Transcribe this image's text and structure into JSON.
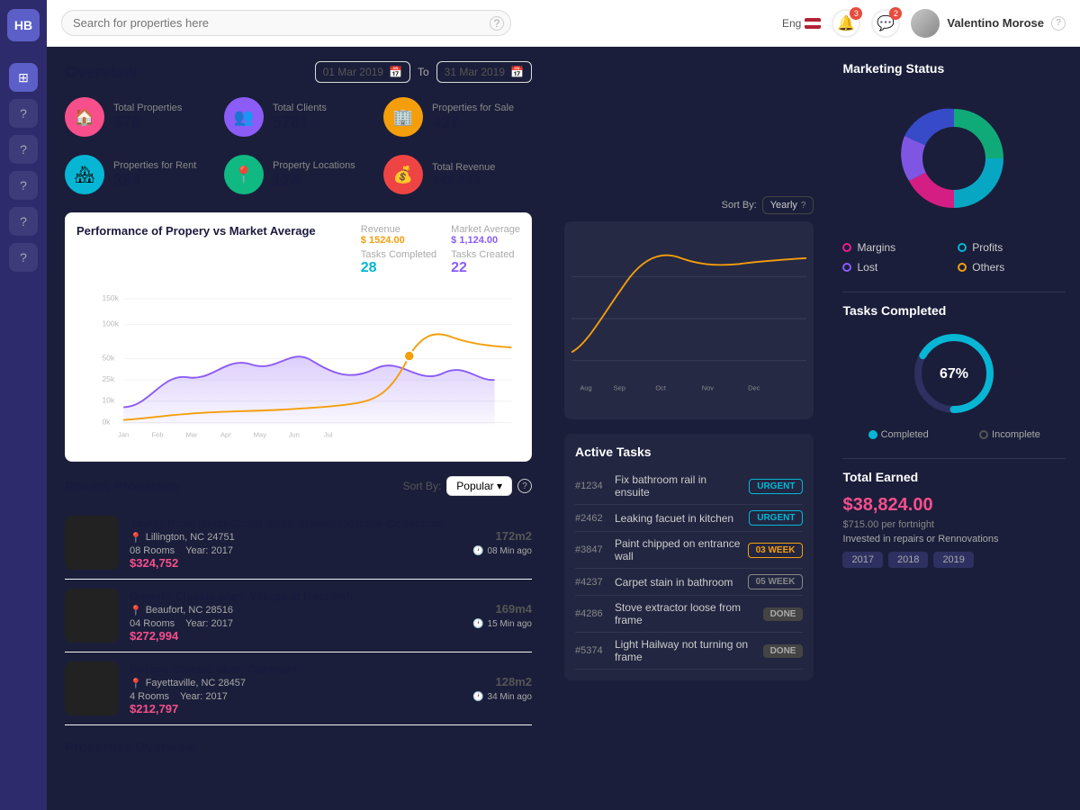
{
  "app": {
    "logo": "HB",
    "search_placeholder": "Search for properties here"
  },
  "topnav": {
    "language": "Eng",
    "user_name": "Valentino Morose",
    "help_label": "?"
  },
  "overview": {
    "title": "Overview",
    "date_from": "01 Mar 2019",
    "date_to": "31 Mar 2019",
    "to_label": "To"
  },
  "stats": [
    {
      "label": "Total Properties",
      "value": "678",
      "icon": "🏠",
      "color": "pink"
    },
    {
      "label": "Total Clients",
      "value": "5781",
      "icon": "👥",
      "color": "purple"
    },
    {
      "label": "Properties for Sale",
      "value": "427",
      "icon": "🏢",
      "color": "orange"
    },
    {
      "label": "Properties for Rent",
      "value": "394",
      "icon": "🏘",
      "color": "cyan"
    },
    {
      "label": "Property Locations",
      "value": "124",
      "icon": "📍",
      "color": "green"
    },
    {
      "label": "Total Revenue",
      "value": "$48,752",
      "icon": "💰",
      "color": "red"
    }
  ],
  "chart": {
    "title": "Performance of Propery vs Market Average",
    "sort_label": "Sort By:",
    "sort_value": "Yearly",
    "revenue_label": "Revenue",
    "revenue_value": "$ 1524.00",
    "market_label": "Market Average",
    "market_value": "$ 1,124.00",
    "tasks_completed_label": "Tasks Completed",
    "tasks_completed_value": "28",
    "tasks_created_label": "Tasks Created",
    "tasks_created_value": "22",
    "y_labels": [
      "150k",
      "100k",
      "50k",
      "25k",
      "10k",
      "0k"
    ],
    "x_labels": [
      "Jan",
      "Feb",
      "Mar",
      "Apr",
      "May",
      "Jun",
      "Jul",
      "Aug",
      "Sep",
      "Oct",
      "Nov",
      "Dec"
    ]
  },
  "recent_properties": {
    "title": "Recent Properties",
    "sort_label": "Sort By:",
    "sort_value": "Popular",
    "items": [
      {
        "name": "Taylor Plan, Beau Coast Beau Shoals Cottage Collection",
        "location": "Lillington, NC 24751",
        "rooms": "08 Rooms",
        "year": "Year: 2017",
        "price": "$324,752",
        "size": "172m2",
        "time": "08 Min ago"
      },
      {
        "name": "Daniels Classic plan, Village at Rockfish",
        "location": "Beaufort, NC 28516",
        "rooms": "04 Rooms",
        "year": "Year: 2017",
        "price": "$272,994",
        "size": "169m4",
        "time": "15 Min ago"
      },
      {
        "name": "Nelson Classic plan, Oakmont",
        "location": "Fayettaville, NC 28457",
        "rooms": "4 Rooms",
        "year": "Year: 2017",
        "price": "$212,797",
        "size": "128m2",
        "time": "34 Min ago"
      }
    ]
  },
  "properties_overview": {
    "title": "Properties Overview"
  },
  "marketing_status": {
    "title": "Marketing  Status",
    "legend": [
      {
        "label": "Margins",
        "color": "#e91e8c",
        "border": "#e91e8c"
      },
      {
        "label": "Profits",
        "color": "#06b6d4",
        "border": "#06b6d4"
      },
      {
        "label": "Lost",
        "color": "#8b5cf6",
        "border": "#8b5cf6"
      },
      {
        "label": "Others",
        "color": "#f59e0b",
        "border": "#f59e0b"
      }
    ]
  },
  "active_tasks": {
    "title": "Active Tasks",
    "items": [
      {
        "id": "#1234",
        "desc": "Fix bathroom rail in ensuite",
        "badge": "URGENT",
        "type": "urgent"
      },
      {
        "id": "#2462",
        "desc": "Leaking facuet in kitchen",
        "badge": "URGENT",
        "type": "urgent"
      },
      {
        "id": "#3847",
        "desc": "Paint chipped on entrance wall",
        "badge": "03 WEEK",
        "type": "week3"
      },
      {
        "id": "#4237",
        "desc": "Carpet stain in bathroom",
        "badge": "05 WEEK",
        "type": "week5"
      },
      {
        "id": "#4286",
        "desc": "Stove extractor loose from frame",
        "badge": "DONE",
        "type": "done"
      },
      {
        "id": "#5374",
        "desc": "Light Hailway not turning on frame",
        "badge": "DONE",
        "type": "done"
      }
    ]
  },
  "tasks_completed": {
    "title": "Tasks Completed",
    "percentage": "67%",
    "completed_label": "Completed",
    "incomplete_label": "Incomplete"
  },
  "total_earned": {
    "title": "Total Earned",
    "amount": "$38,824.00",
    "per_period": "$715.00 per fortnight",
    "invested_label": "Invested in repairs or Rennovations",
    "years": [
      "2017",
      "2018",
      "2019"
    ]
  }
}
